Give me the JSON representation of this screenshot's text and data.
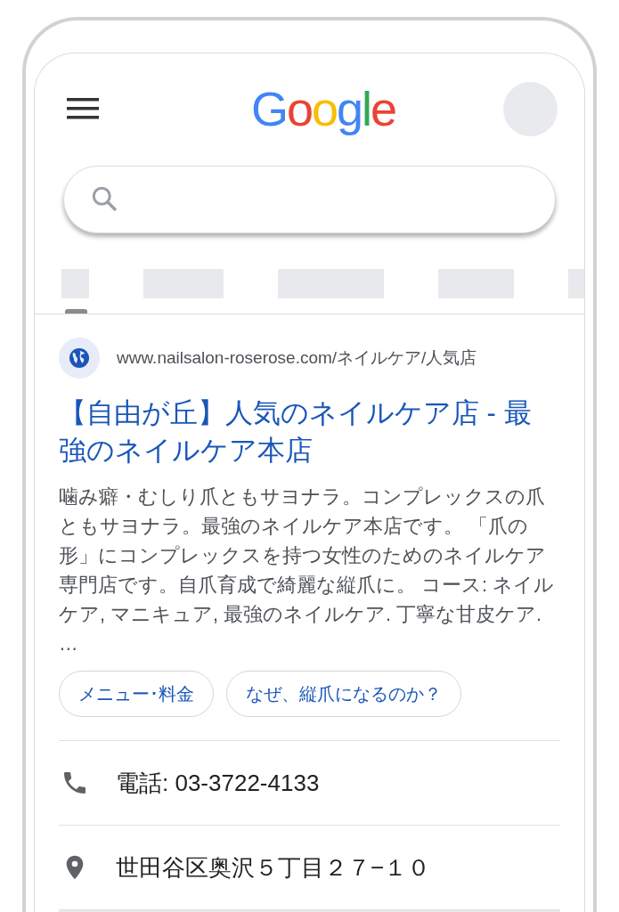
{
  "header": {
    "logo": "Google"
  },
  "result": {
    "url": "www.nailsalon-roserose.com/ネイルケア/人気店",
    "title": "【自由が丘】人気のネイルケア店 - 最強のネイルケア本店",
    "snippet": "噛み癖・むしり爪ともサヨナラ。コンプレックスの爪ともサヨナラ。最強のネイルケア本店です。 「爪の形」にコンプレックスを持つ女性のためのネイルケア専門店です。自爪育成で綺麗な縦爪に。 コース: ネイルケア, マニキュア, 最強のネイルケア. 丁寧な甘皮ケア. …",
    "chips": [
      "メニュー･料金",
      "なぜ、縦爪になるのか？"
    ]
  },
  "details": [
    {
      "kind": "phone",
      "text": "電話: 03-3722-4133"
    },
    {
      "kind": "address",
      "text": "世田谷区奥沢５丁目２７−１０"
    }
  ]
}
